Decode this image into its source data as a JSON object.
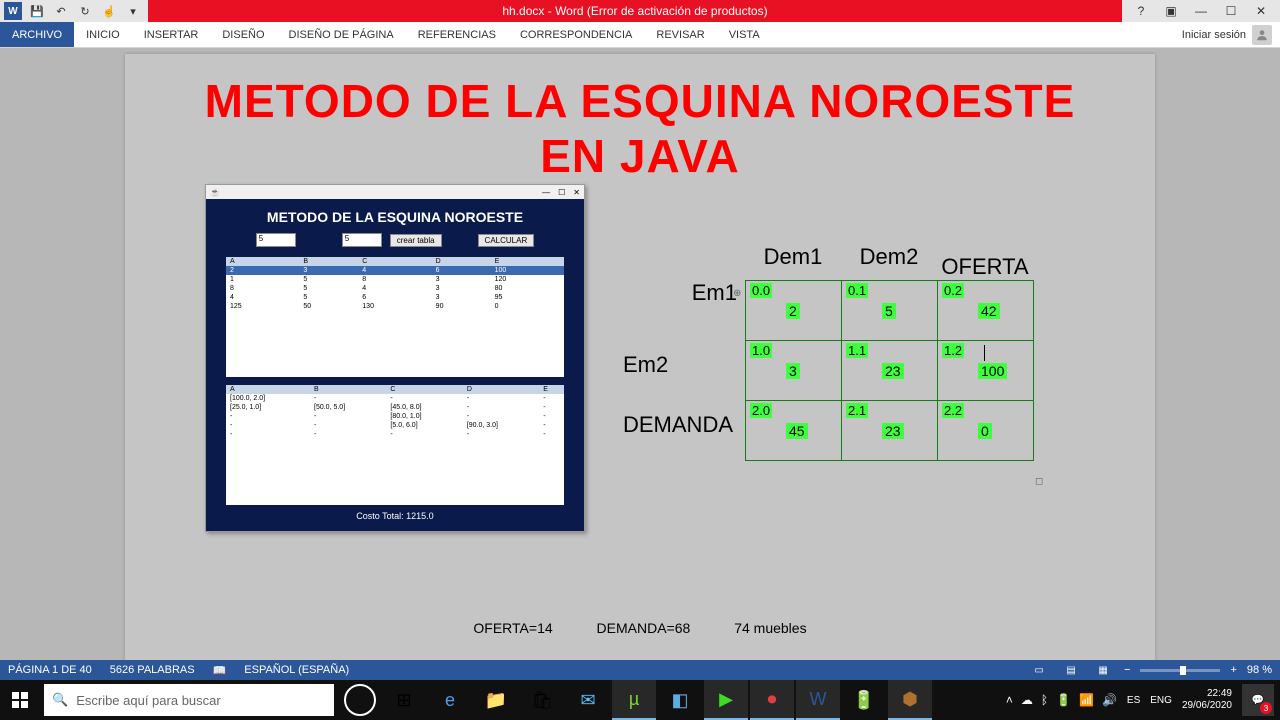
{
  "titlebar": {
    "doc_title": "hh.docx - Word (Error de activación de productos)"
  },
  "ribbon": {
    "file": "ARCHIVO",
    "tabs": [
      "INICIO",
      "INSERTAR",
      "DISEÑO",
      "DISEÑO DE PÁGINA",
      "REFERENCIAS",
      "CORRESPONDENCIA",
      "REVISAR",
      "VISTA"
    ],
    "signin": "Iniciar sesión"
  },
  "document": {
    "title_line1": "METODO DE LA ESQUINA NOROESTE",
    "title_line2": "EN JAVA",
    "bottom": {
      "oferta": "OFERTA=14",
      "demanda": "DEMANDA=68",
      "muebles": "74 muebles"
    }
  },
  "java_app": {
    "heading": "METODO DE LA ESQUINA NOROESTE",
    "input1": "5",
    "input2": "5",
    "btn_create": "crear tabla",
    "btn_calc": "CALCULAR",
    "cols": [
      "A",
      "B",
      "C",
      "D",
      "E"
    ],
    "rows1": [
      [
        "2",
        "3",
        "4",
        "6",
        "100"
      ],
      [
        "1",
        "5",
        "8",
        "3",
        "120"
      ],
      [
        "8",
        "5",
        "4",
        "3",
        "80"
      ],
      [
        "4",
        "5",
        "6",
        "3",
        "95"
      ],
      [
        "125",
        "50",
        "130",
        "90",
        "0"
      ]
    ],
    "rows2": [
      [
        "[100.0, 2.0]",
        "-",
        "-",
        "-",
        "-"
      ],
      [
        "[25.0, 1.0]",
        "[50.0, 5.0]",
        "[45.0, 8.0]",
        "-",
        "-"
      ],
      [
        "-",
        "-",
        "[80.0, 1.0]",
        "-",
        "-"
      ],
      [
        "-",
        "-",
        "[5.0, 6.0]",
        "[90.0, 3.0]",
        "-"
      ],
      [
        "-",
        "-",
        "-",
        "-",
        "-"
      ]
    ],
    "cost": "Costo Total: 1215.0"
  },
  "matrix": {
    "top_labels": [
      "Dem1",
      "Dem2",
      "OFERTA"
    ],
    "row_labels": [
      "Em1",
      "Em2",
      "DEMANDA"
    ],
    "cells": [
      [
        {
          "id": "0.0",
          "val": "2"
        },
        {
          "id": "0.1",
          "val": "5"
        },
        {
          "id": "0.2",
          "val": "42"
        }
      ],
      [
        {
          "id": "1.0",
          "val": "3"
        },
        {
          "id": "1.1",
          "val": "23"
        },
        {
          "id": "1.2",
          "val": "100"
        }
      ],
      [
        {
          "id": "2.0",
          "val": "45"
        },
        {
          "id": "2.1",
          "val": "23"
        },
        {
          "id": "2.2",
          "val": "0"
        }
      ]
    ]
  },
  "statusbar": {
    "page": "PÁGINA 1 DE 40",
    "words": "5626 PALABRAS",
    "lang": "ESPAÑOL (ESPAÑA)",
    "zoom": "98 %"
  },
  "taskbar": {
    "search_placeholder": "Escribe aquí para buscar",
    "lang1": "ES",
    "lang2": "ENG",
    "time": "22:49",
    "date": "29/06/2020",
    "notif_count": "3"
  }
}
